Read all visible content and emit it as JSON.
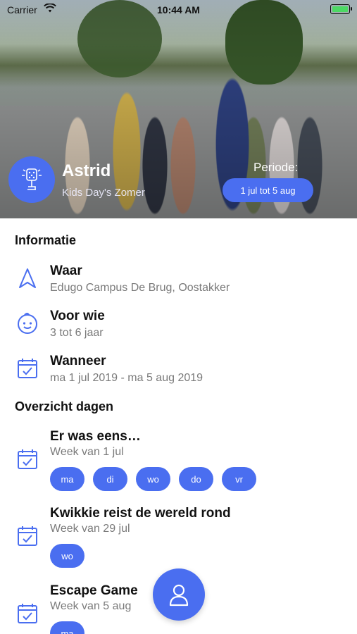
{
  "status_bar": {
    "carrier": "Carrier",
    "time": "10:44 AM",
    "battery_level": 0.9
  },
  "hero": {
    "activity_name": "Astrid",
    "activity_subtitle": "Kids Day's Zomer",
    "periode_label": "Periode:",
    "periode_value": "1 jul tot 5 aug",
    "icon": "microphone-icon"
  },
  "info": {
    "section_title": "Informatie",
    "rows": [
      {
        "title": "Waar",
        "value": "Edugo Campus De Brug, Oostakker",
        "icon": "location-arrow-icon"
      },
      {
        "title": "Voor wie",
        "value": "3 tot 6 jaar",
        "icon": "child-face-icon"
      },
      {
        "title": "Wanneer",
        "value": "ma 1 jul 2019 - ma 5 aug 2019",
        "icon": "calendar-check-icon"
      }
    ]
  },
  "days": {
    "section_title": "Overzicht dagen",
    "weeks": [
      {
        "title": "Er was eens…",
        "subtitle": "Week van 1 jul",
        "days": [
          "ma",
          "di",
          "wo",
          "do",
          "vr"
        ]
      },
      {
        "title": "Kwikkie reist de wereld rond",
        "subtitle": "Week van 29 jul",
        "days": [
          "wo"
        ]
      },
      {
        "title": "Escape Game",
        "subtitle": "Week van 5 aug",
        "days": [
          "ma"
        ]
      }
    ]
  },
  "fab": {
    "icon": "person-icon"
  },
  "colors": {
    "accent": "#4a6ef0",
    "muted_text": "#7a7a7a"
  }
}
